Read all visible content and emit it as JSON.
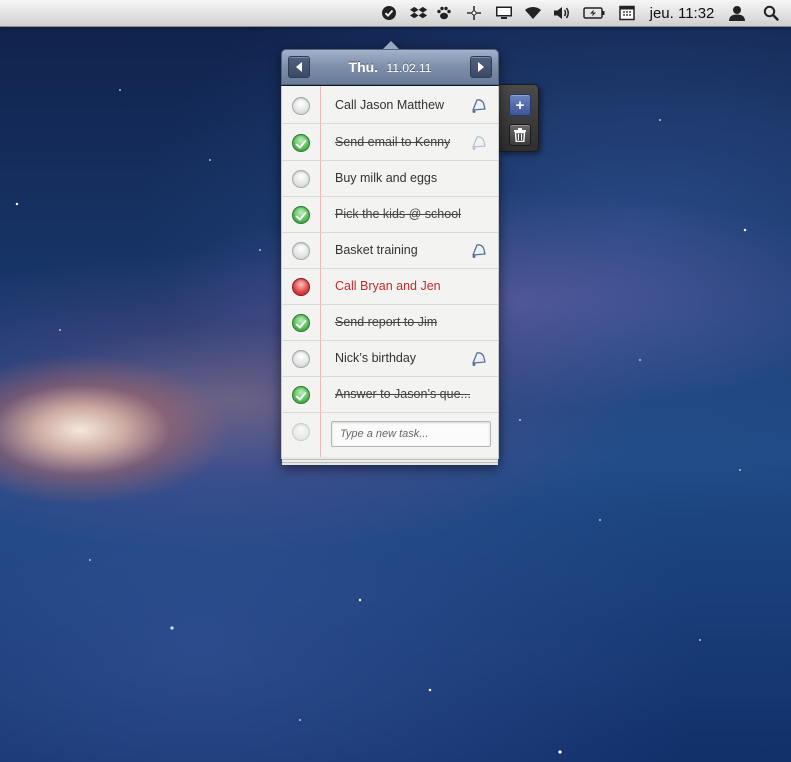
{
  "menubar": {
    "clock": "jeu. 11:32",
    "icons": [
      "check-circle-icon",
      "dropbox-icon",
      "paw-icon",
      "sparkle-icon",
      "display-icon",
      "wifi-icon",
      "volume-icon",
      "battery-icon",
      "calendar-icon",
      "user-icon",
      "spotlight-search-icon"
    ]
  },
  "popover": {
    "day": "Thu.",
    "date": "11.02.11",
    "new_task_placeholder": "Type a new task...",
    "tasks": [
      {
        "label": "Call Jason Matthew",
        "status": "pending",
        "reminder": true
      },
      {
        "label": "Send email to Kenny",
        "status": "done",
        "reminder": true
      },
      {
        "label": "Buy milk and eggs",
        "status": "pending",
        "reminder": false
      },
      {
        "label": "Pick the kids @ school",
        "status": "done",
        "reminder": false
      },
      {
        "label": "Basket training",
        "status": "pending",
        "reminder": true
      },
      {
        "label": "Call Bryan and Jen",
        "status": "urgent",
        "reminder": false
      },
      {
        "label": "Send report to Jim",
        "status": "done",
        "reminder": false
      },
      {
        "label": "Nick’s birthday",
        "status": "pending",
        "reminder": true
      },
      {
        "label": "Answer to Jason’s que...",
        "status": "done",
        "reminder": false
      }
    ]
  },
  "toolbar": {
    "add_label": "+",
    "add_icon": "plus-icon",
    "trash_icon": "trash-icon"
  },
  "colors": {
    "header_blue": "#7d8ea9",
    "done_green": "#59c25a",
    "urgent_red": "#c92a2a",
    "add_button_blue": "#4f68aa"
  }
}
